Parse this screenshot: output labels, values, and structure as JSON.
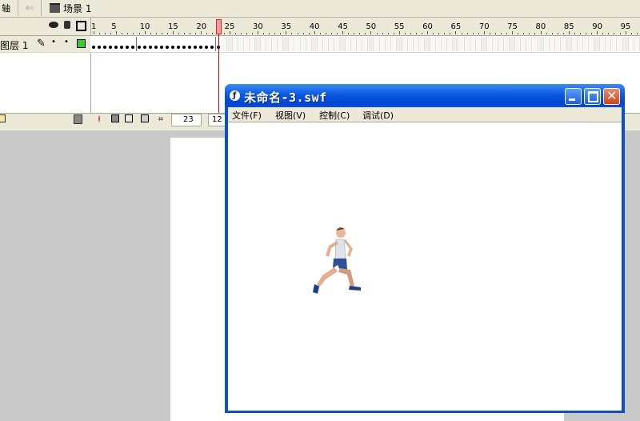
{
  "scene_bar": {
    "timeline_label": "轴",
    "scene_name": "场景 1"
  },
  "timeline": {
    "layer_name": "图层 1",
    "frame_ticks": [
      "1",
      "5",
      "10",
      "15",
      "20",
      "25",
      "30",
      "35",
      "40",
      "45",
      "50",
      "55",
      "60",
      "65",
      "70",
      "75",
      "80",
      "85",
      "90",
      "95"
    ],
    "current_frame": "23",
    "frame_rate": "12"
  },
  "swf_window": {
    "title": "未命名-3.swf",
    "menus": [
      "文件(F)",
      "视图(V)",
      "控制(C)",
      "调试(D)"
    ]
  },
  "icons": [
    "arrow-left-icon",
    "scene-clapper-icon",
    "eye-icon",
    "lock-icon",
    "outline-square-icon",
    "pencil-icon",
    "layer-color-swatch-icon",
    "folder-icon",
    "trash-icon",
    "center-frame-icon",
    "onion-skin-icon",
    "onion-outline-icon",
    "edit-multiple-frames-icon",
    "modify-onion-markers-icon",
    "flash-player-icon",
    "minimize-icon",
    "maximize-icon",
    "close-icon",
    "runner-figure"
  ],
  "colors": {
    "title_bar": "#0a58e0",
    "playhead": "#cc0000",
    "layer_swatch": "#33cc33"
  }
}
